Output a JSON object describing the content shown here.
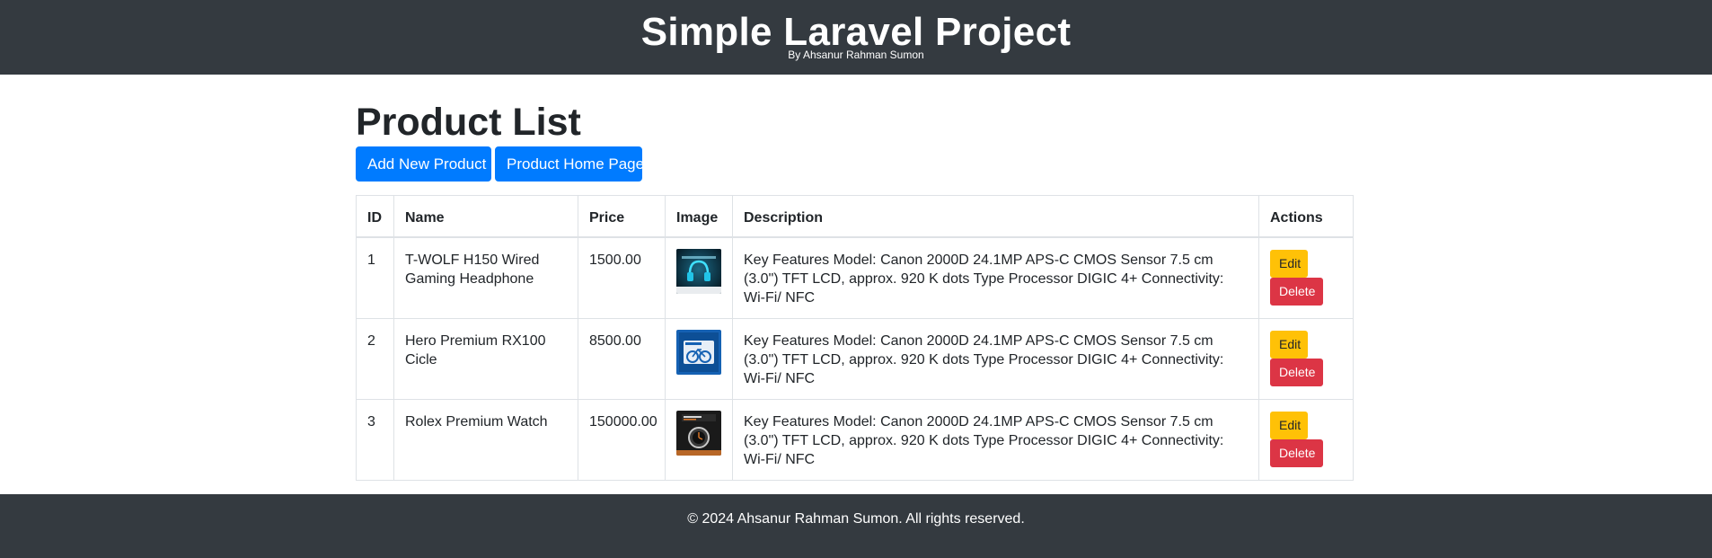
{
  "header": {
    "title": "Simple Laravel Project",
    "subtitle": "By Ahsanur Rahman Sumon"
  },
  "main": {
    "page_title": "Product List",
    "add_button_label": "Add New Product",
    "home_button_label": "Product Home Page"
  },
  "table": {
    "columns": [
      "ID",
      "Name",
      "Price",
      "Image",
      "Description",
      "Actions"
    ],
    "rows": [
      {
        "id": "1",
        "name": "T-WOLF H150 Wired Gaming Headphone",
        "price": "1500.00",
        "image": "headphone-thumbnail",
        "description": "Key Features Model: Canon 2000D 24.1MP APS-C CMOS Sensor 7.5 cm (3.0\") TFT LCD, approx. 920 K dots Type Processor DIGIC 4+ Connectivity: Wi-Fi/ NFC",
        "edit_label": "Edit",
        "delete_label": "Delete"
      },
      {
        "id": "2",
        "name": "Hero Premium RX100 Cicle",
        "price": "8500.00",
        "image": "cycle-thumbnail",
        "description": "Key Features Model: Canon 2000D 24.1MP APS-C CMOS Sensor 7.5 cm (3.0\") TFT LCD, approx. 920 K dots Type Processor DIGIC 4+ Connectivity: Wi-Fi/ NFC",
        "edit_label": "Edit",
        "delete_label": "Delete"
      },
      {
        "id": "3",
        "name": "Rolex Premium Watch",
        "price": "150000.00",
        "image": "watch-thumbnail",
        "description": "Key Features Model: Canon 2000D 24.1MP APS-C CMOS Sensor 7.5 cm (3.0\") TFT LCD, approx. 920 K dots Type Processor DIGIC 4+ Connectivity: Wi-Fi/ NFC",
        "edit_label": "Edit",
        "delete_label": "Delete"
      }
    ]
  },
  "footer": {
    "text": "© 2024 Ahsanur Rahman Sumon. All rights reserved."
  },
  "colors": {
    "header_bg": "#343a40",
    "primary": "#007bff",
    "warning": "#ffc107",
    "danger": "#dc3545"
  }
}
